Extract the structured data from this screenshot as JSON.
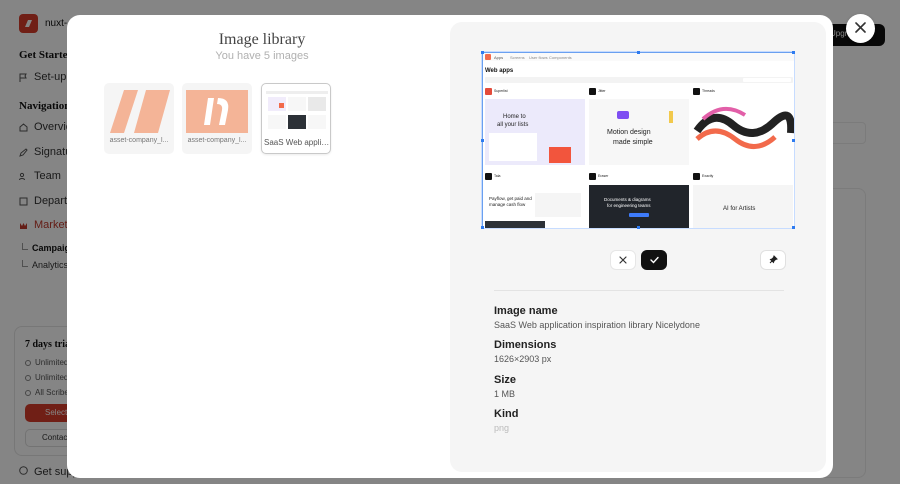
{
  "app": {
    "name": "nuxt-",
    "top_action": "Upgrade",
    "sidebar": {
      "getting_started": "Get Started",
      "setup": "Set-up",
      "navigation": "Navigation",
      "items": [
        "Overview",
        "Signatures",
        "Team",
        "Departments",
        "Marketing"
      ],
      "sub_items": [
        "Campaigns",
        "Analytics"
      ],
      "trial": {
        "title": "7 days trial",
        "features": [
          "Unlimited",
          "Unlimited",
          "All Scribe"
        ],
        "primary": "Select",
        "secondary": "Contact"
      },
      "support": "Get support"
    }
  },
  "modal": {
    "title": "Image library",
    "subtitle": "You have 5 images",
    "thumbnails": [
      {
        "label": "asset-company_l...",
        "kind": "logo-wide"
      },
      {
        "label": "asset-company_l...",
        "kind": "logo-square"
      },
      {
        "label": "SaaS Web applic...",
        "kind": "screenshot",
        "selected": true
      }
    ],
    "details": {
      "name_label": "Image name",
      "name_value": "SaaS Web application inspiration library  Nicelydone",
      "dimensions_label": "Dimensions",
      "dimensions_value": "1626×2903 px",
      "size_label": "Size",
      "size_value": "1 MB",
      "kind_label": "Kind",
      "kind_value": "png"
    },
    "preview": {
      "nav": [
        "Apps",
        "Screens",
        "User flows",
        "Components"
      ],
      "heading": "Web apps",
      "tiles": [
        {
          "title": "Superlist",
          "headline": "Home to all your lists"
        },
        {
          "title": "Jitter",
          "headline": "Motion design made simple"
        },
        {
          "title": "Threads",
          "headline": ""
        },
        {
          "title": "Tala",
          "headline": "Payflow, get paid and manage cash flow"
        },
        {
          "title": "Eraser",
          "headline": "Documents & diagrams for engineering teams"
        },
        {
          "title": "Exactly",
          "headline": "AI for Artists"
        }
      ]
    }
  },
  "colors": {
    "brand": "#d63d2b",
    "logo_tile": "#f4b497",
    "accent_blue": "#2e7bf0"
  }
}
